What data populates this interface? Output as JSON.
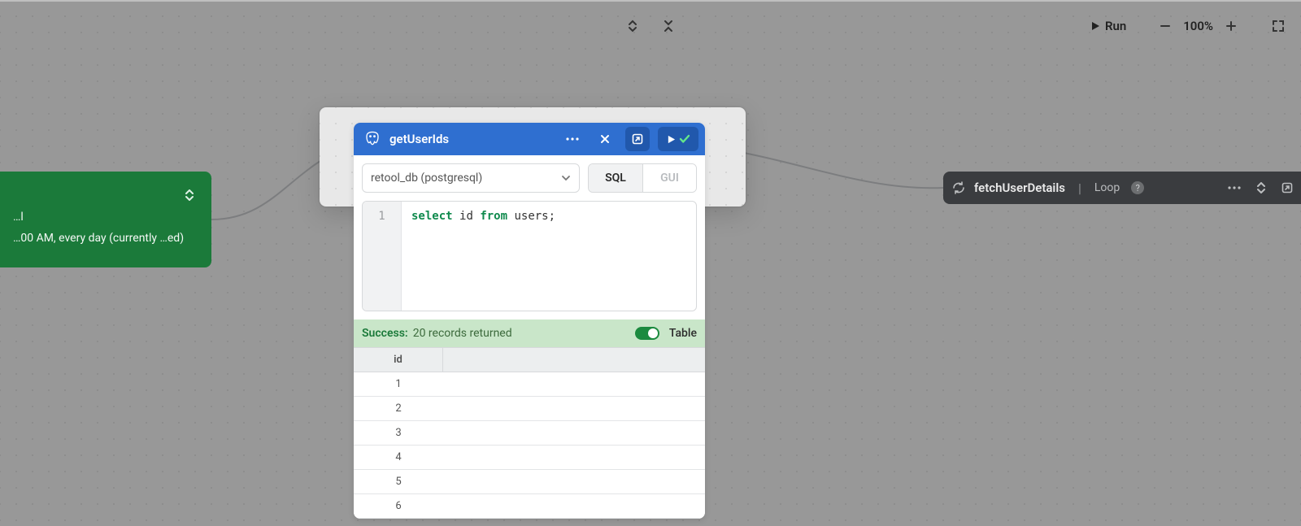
{
  "topbar": {
    "run_label": "Run",
    "zoom": "100%"
  },
  "left_node": {
    "line1": "…l",
    "line2": "…00 AM, every day (currently …ed)"
  },
  "right_node": {
    "title": "fetchUserDetails",
    "subtitle": "Loop"
  },
  "query_node": {
    "title": "getUserIds",
    "datasource": "retool_db (postgresql)",
    "mode": {
      "sql": "SQL",
      "gui": "GUI"
    },
    "code": {
      "line_no": "1",
      "kw_select": "select",
      "ident_id": "id",
      "kw_from": "from",
      "rest": " users;"
    },
    "status": {
      "label": "Success:",
      "message": "20 records returned",
      "view": "Table"
    },
    "table": {
      "header": "id",
      "rows": [
        "1",
        "2",
        "3",
        "4",
        "5",
        "6"
      ]
    }
  }
}
